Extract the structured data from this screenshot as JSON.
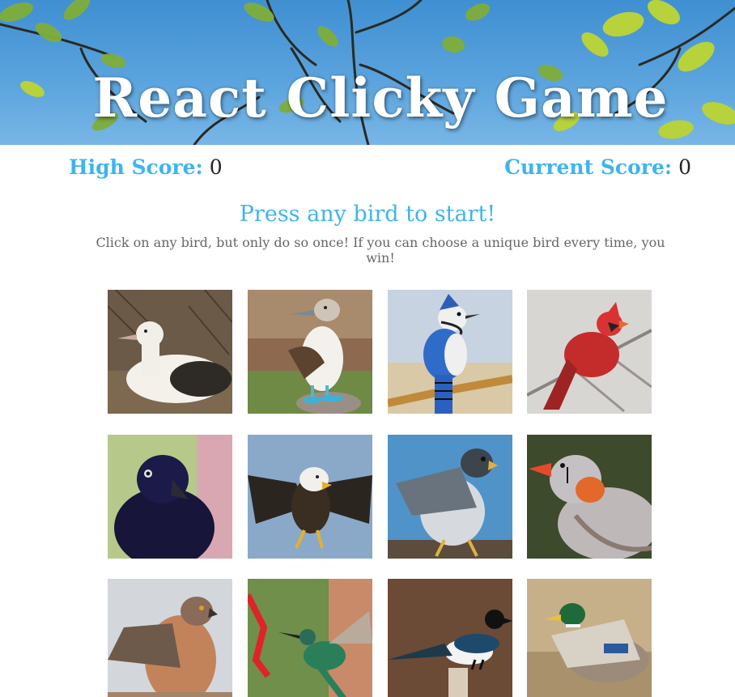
{
  "header": {
    "title": "React Clicky Game",
    "sky_color": "#4a98d8"
  },
  "scores": {
    "high_label": "High Score:",
    "high_value": "0",
    "current_label": "Current Score:",
    "current_value": "0"
  },
  "instructions": {
    "headline": "Press any bird to start!",
    "subtext": "Click on any bird, but only do so once! If you can choose a unique bird every time, you win!"
  },
  "colors": {
    "accent": "#3fb4ee",
    "subtext": "#666666"
  },
  "birds": [
    {
      "name": "albatross",
      "icon": "albatross-image"
    },
    {
      "name": "blue-footed-booby",
      "icon": "booby-image"
    },
    {
      "name": "blue-jay",
      "icon": "blue-jay-image"
    },
    {
      "name": "northern-cardinal",
      "icon": "cardinal-image"
    },
    {
      "name": "crow",
      "icon": "crow-image"
    },
    {
      "name": "bald-eagle",
      "icon": "eagle-image"
    },
    {
      "name": "peregrine-falcon",
      "icon": "falcon-image"
    },
    {
      "name": "zebra-finch",
      "icon": "finch-image"
    },
    {
      "name": "hawk",
      "icon": "hawk-image"
    },
    {
      "name": "hummingbird",
      "icon": "hummingbird-image"
    },
    {
      "name": "magpie",
      "icon": "magpie-image"
    },
    {
      "name": "mallard",
      "icon": "mallard-image"
    }
  ]
}
